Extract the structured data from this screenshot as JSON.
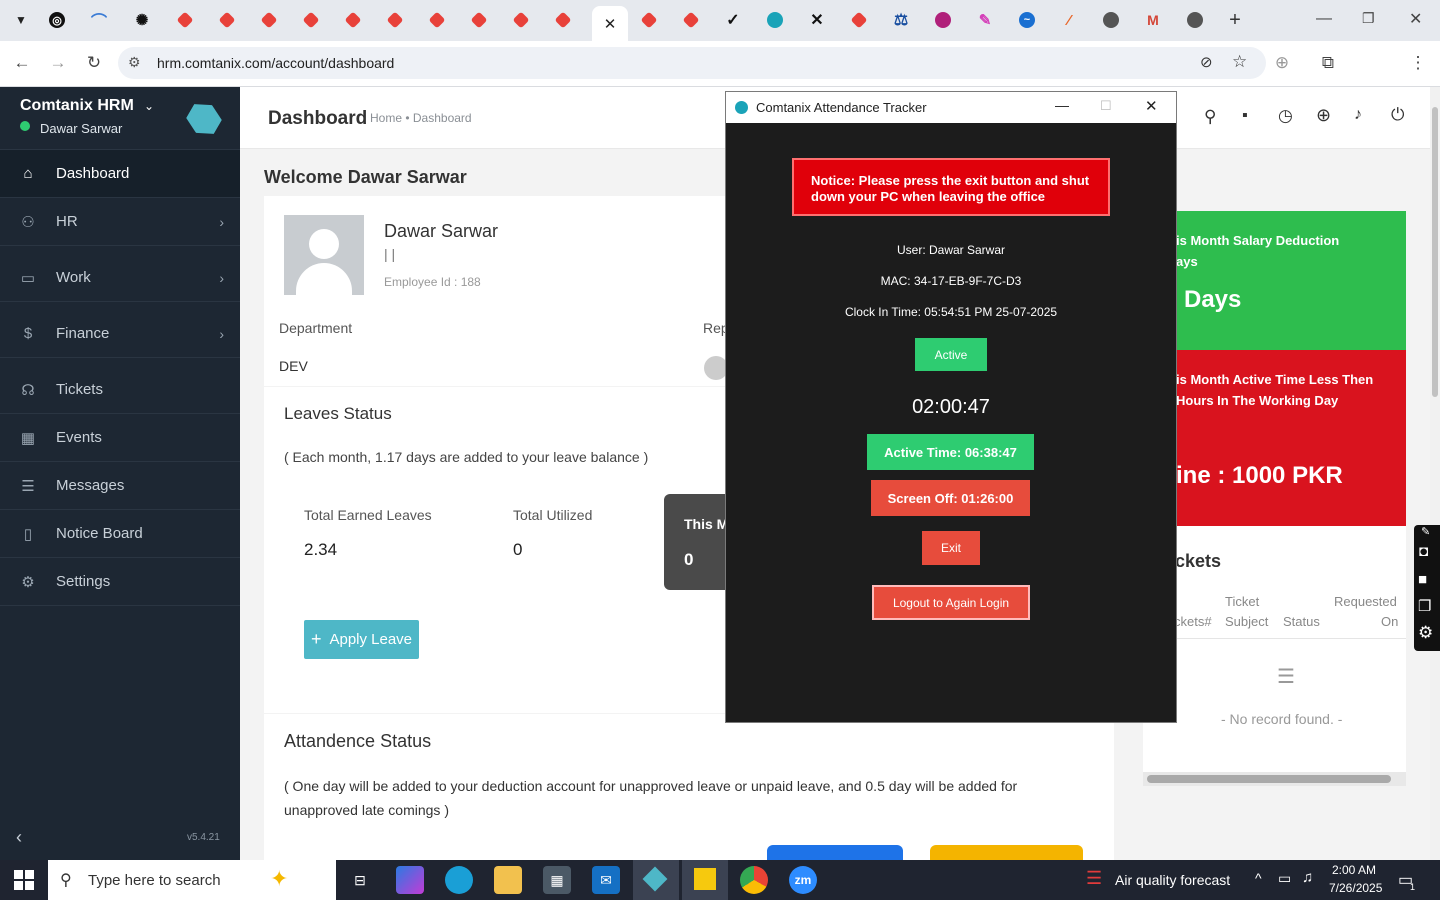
{
  "browser": {
    "url": "hrm.comtanix.com/account/dashboard",
    "new_tab_symbol": "+"
  },
  "sidebar": {
    "brand": "Comtanix HRM",
    "user": "Dawar Sarwar",
    "version": "v5.4.21",
    "items": [
      {
        "label": "Dashboard",
        "icon": "home-icon"
      },
      {
        "label": "HR",
        "icon": "people-icon"
      },
      {
        "label": "Work",
        "icon": "briefcase-icon"
      },
      {
        "label": "Finance",
        "icon": "dollar-icon"
      },
      {
        "label": "Tickets",
        "icon": "headset-icon"
      },
      {
        "label": "Events",
        "icon": "calendar-icon"
      },
      {
        "label": "Messages",
        "icon": "message-icon"
      },
      {
        "label": "Notice Board",
        "icon": "clipboard-icon"
      },
      {
        "label": "Settings",
        "icon": "gear-icon"
      }
    ]
  },
  "header": {
    "title": "Dashboard",
    "breadcrumb": "Home • Dashboard"
  },
  "welcome": "Welcome Dawar Sarwar",
  "profile": {
    "name": "Dawar Sarwar",
    "subtitle": "| |",
    "employee_id": "Employee Id : 188",
    "department_label": "Department",
    "department_value": "DEV",
    "rep_label": "Rep"
  },
  "leaves": {
    "title": "Leaves Status",
    "note": "( Each month, 1.17 days are added to your leave balance )",
    "earned_label": "Total Earned Leaves",
    "earned_value": "2.34",
    "utilized_label": "Total Utilized",
    "utilized_value": "0",
    "month_label": "This M",
    "month_value": "0",
    "apply_button": "Apply Leave"
  },
  "attendance": {
    "title": "Attandence Status",
    "note": "( One day will be added to your deduction account for unapproved leave or unpaid leave, and 0.5 day will be added for unapproved late comings )"
  },
  "right_cards": {
    "salary_title_1": "is Month Salary Deduction",
    "salary_title_2": "ays",
    "salary_value": "Days",
    "active_title_1": "is Month Active Time Less Then",
    "active_title_2": "Hours In The Working Day",
    "fine": "ine : 1000 PKR",
    "tickets_title": "ckets",
    "col1": "ckets#",
    "col2a": "Ticket",
    "col2b": "Subject",
    "col3": "Status",
    "col4a": "Requested",
    "col4b": "On",
    "empty": "- No record found. -"
  },
  "tracker": {
    "window_title": "Comtanix Attendance Tracker",
    "notice": "Notice: Please press the exit button and shut down your PC when leaving the office",
    "user": "User: Dawar Sarwar",
    "mac": "MAC: 34-17-EB-9F-7C-D3",
    "clock_in": "Clock In Time: 05:54:51 PM 25-07-2025",
    "status": "Active",
    "timer": "02:00:47",
    "active_time": "Active Time: 06:38:47",
    "screen_off": "Screen Off: 01:26:00",
    "exit": "Exit",
    "logout": "Logout to Again Login"
  },
  "taskbar": {
    "search_placeholder": "Type here to search",
    "weather": "Air quality forecast",
    "time": "2:00 AM",
    "date": "7/26/2025",
    "notif_count": "1"
  },
  "colors": {
    "sidebar": "#1d2733",
    "accent_teal": "#4eb7c7",
    "green": "#2ebd4e",
    "red": "#d9131e",
    "tracker_bg": "#1c1c1c"
  }
}
